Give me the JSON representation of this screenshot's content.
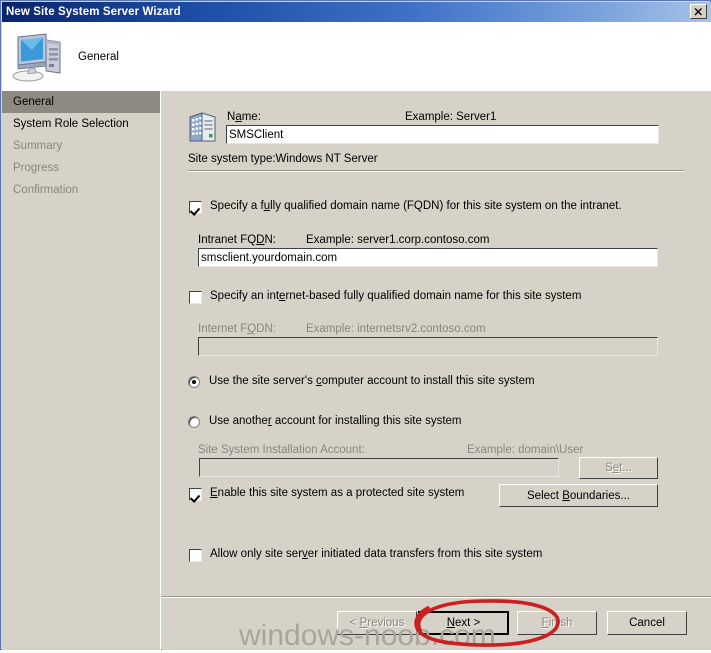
{
  "window": {
    "title": "New Site System Server Wizard",
    "close_label": "✕"
  },
  "header": {
    "title": "General",
    "icon": "computer-icon"
  },
  "sidebar": {
    "items": [
      {
        "label": "General",
        "state": "selected"
      },
      {
        "label": "System Role Selection",
        "state": "enabled"
      },
      {
        "label": "Summary",
        "state": "disabled"
      },
      {
        "label": "Progress",
        "state": "disabled"
      },
      {
        "label": "Confirmation",
        "state": "disabled"
      }
    ]
  },
  "form": {
    "name_label": "Name:",
    "name_example": "Example: Server1",
    "name_value": "SMSClient",
    "site_system_type": "Site system type:Windows NT Server",
    "fqdn_checkbox_label": "Specify a fully qualified domain name (FQDN) for this site system on the intranet.",
    "fqdn_checked": true,
    "intranet_fqdn_label": "Intranet FQDN:",
    "intranet_fqdn_example": "Example: server1.corp.contoso.com",
    "intranet_fqdn_value": "smsclient.yourdomain.com",
    "internet_checkbox_label": "Specify an internet-based fully qualified domain name for this site system",
    "internet_checked": false,
    "internet_fqdn_label": "Internet FQDN:",
    "internet_fqdn_example": "Example: internetsrv2.contoso.com",
    "internet_fqdn_value": "",
    "radio_computer_account_label": "Use the site server's computer account to install this site system",
    "radio_other_account_label": "Use another account for installing this site system",
    "radio_selected": "computer_account",
    "install_account_label": "Site System Installation Account:",
    "install_account_example": "Example: domain\\User",
    "install_account_value": "",
    "set_button_label": "Set...",
    "protected_checkbox_label": "Enable this site system as a protected site system",
    "protected_checked": true,
    "select_boundaries_label": "Select Boundaries...",
    "server_initiated_checkbox_label": "Allow only site server initiated data transfers from this site system",
    "server_initiated_checked": false
  },
  "buttons": {
    "previous": "< Previous",
    "next": "Next >",
    "finish": "Finish",
    "cancel": "Cancel"
  },
  "watermark": {
    "text": "windows-noob.com"
  },
  "colors": {
    "titlebar_start": "#0a246a",
    "titlebar_end": "#a8c4e8",
    "dialog_face": "#d6d2c8",
    "selection": "#8d8a82",
    "disabled_text": "#8a867d",
    "annotation": "#cc1f1f"
  }
}
